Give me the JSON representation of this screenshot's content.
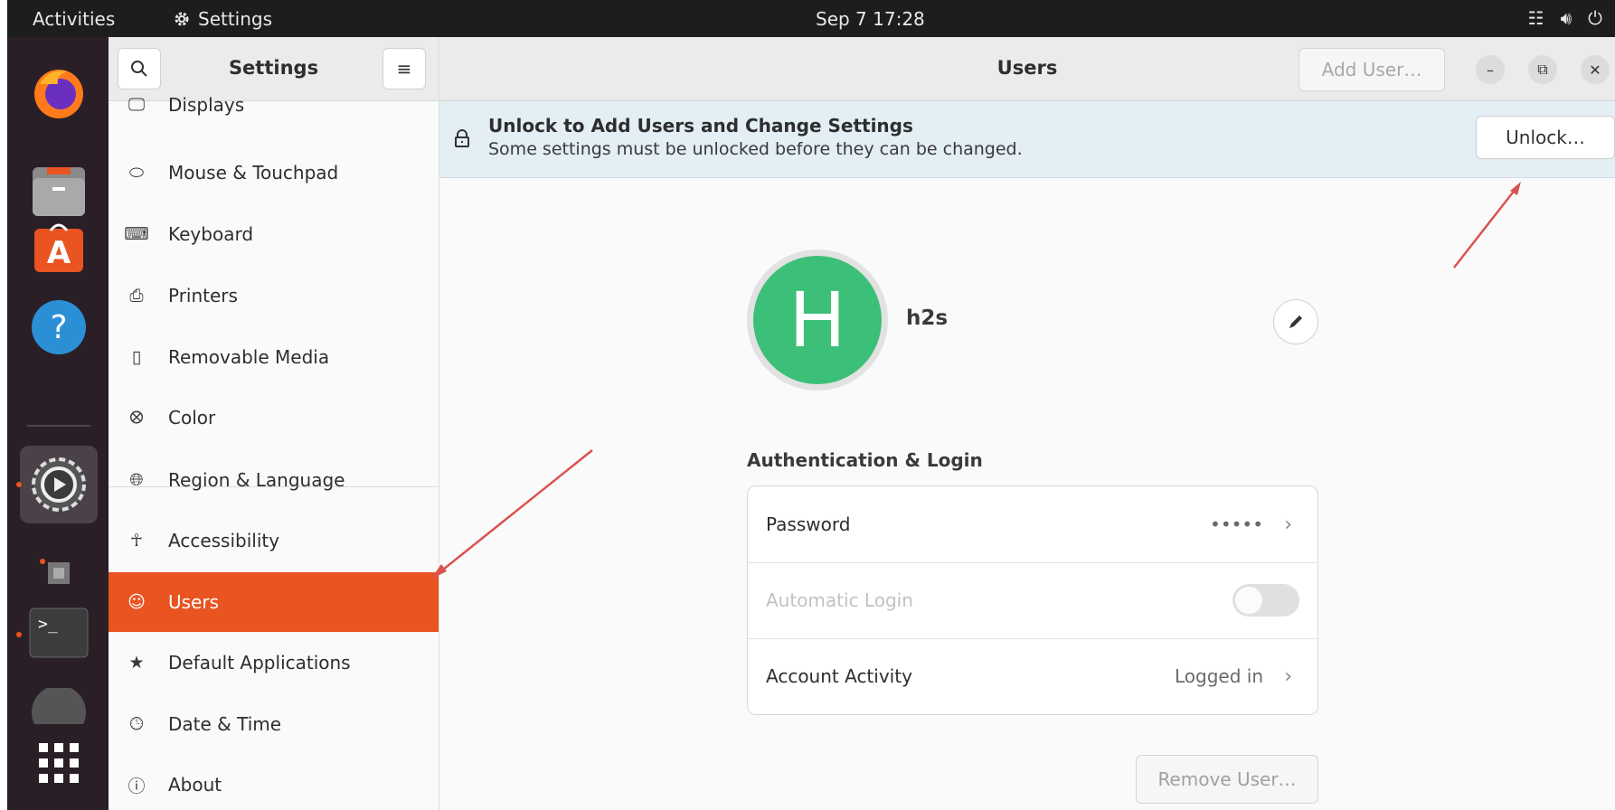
{
  "topbar": {
    "activities": "Activities",
    "app_name": "Settings",
    "clock": "Sep 7  17:28",
    "tray_icons": [
      "network-icon",
      "volume-icon",
      "power-icon"
    ]
  },
  "dock": {
    "items": [
      "firefox-icon",
      "files-icon",
      "app-center-icon",
      "help-icon",
      "settings-icon",
      "screenshot-icon",
      "terminal-icon",
      "disk-icon",
      "show-apps-icon"
    ]
  },
  "sidebar": {
    "title": "Settings",
    "items": [
      {
        "label": "Displays",
        "icon": "display-icon"
      },
      {
        "label": "Mouse & Touchpad",
        "icon": "mouse-icon"
      },
      {
        "label": "Keyboard",
        "icon": "keyboard-icon"
      },
      {
        "label": "Printers",
        "icon": "printer-icon"
      },
      {
        "label": "Removable Media",
        "icon": "media-icon"
      },
      {
        "label": "Color",
        "icon": "color-icon"
      },
      {
        "label": "Region & Language",
        "icon": "globe-icon"
      },
      {
        "label": "Accessibility",
        "icon": "accessibility-icon"
      },
      {
        "label": "Users",
        "icon": "users-icon",
        "active": true
      },
      {
        "label": "Default Applications",
        "icon": "star-icon"
      },
      {
        "label": "Date & Time",
        "icon": "clock-icon"
      },
      {
        "label": "About",
        "icon": "info-icon"
      }
    ]
  },
  "main": {
    "title": "Users",
    "add_user": "Add User…",
    "infobar": {
      "title": "Unlock to Add Users and Change Settings",
      "subtitle": "Some settings must be unlocked before they can be changed.",
      "unlock": "Unlock…"
    },
    "user": {
      "avatar_letter": "H",
      "name": "h2s"
    },
    "auth": {
      "section_title": "Authentication & Login",
      "password_label": "Password",
      "password_value": "•••••",
      "auto_login_label": "Automatic Login",
      "auto_login_enabled": false,
      "activity_label": "Account Activity",
      "activity_value": "Logged in"
    },
    "remove_user": "Remove User…"
  },
  "colors": {
    "accent": "#e95420",
    "avatar": "#3cbf78",
    "dock": "#2a1f27",
    "annotation_arrow": "#d9534f"
  }
}
